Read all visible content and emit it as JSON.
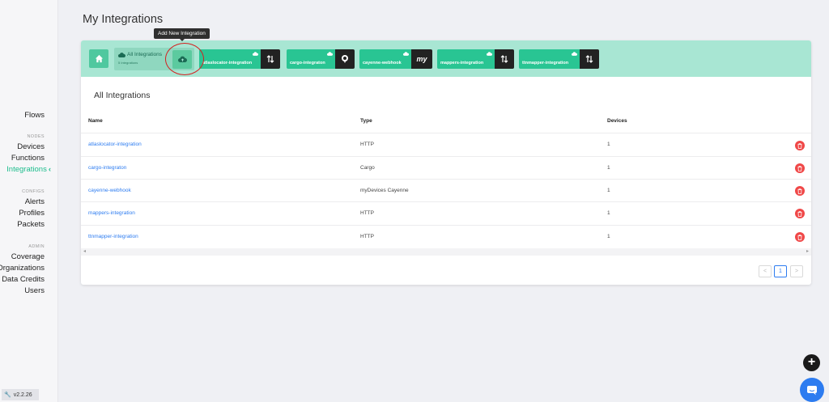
{
  "sidebar": {
    "flows": "Flows",
    "nodes_section": "NODES",
    "devices": "Devices",
    "functions": "Functions",
    "integrations": "Integrations",
    "configs_section": "CONFIGS",
    "alerts": "Alerts",
    "profiles": "Profiles",
    "packets": "Packets",
    "admin_section": "ADMIN",
    "coverage": "Coverage",
    "organizations": "Organizations",
    "data_credits": "Data Credits",
    "users": "Users",
    "version": "v2.2.26"
  },
  "page": {
    "title": "My Integrations"
  },
  "tooltip": {
    "text": "Add New Integration"
  },
  "tabs": {
    "all_label": "All Integrations",
    "all_sub": "5 Integrations",
    "items": [
      {
        "name": "atlaslocator-integration",
        "logo": "arrows-icon"
      },
      {
        "name": "cargo-integraton",
        "logo": "cargo-icon"
      },
      {
        "name": "cayenne-webhook",
        "logo": "my"
      },
      {
        "name": "mappers-integration",
        "logo": "arrows-icon"
      },
      {
        "name": "ttnmapper-integration",
        "logo": "arrows-icon"
      }
    ]
  },
  "table": {
    "title": "All Integrations",
    "headers": {
      "name": "Name",
      "type": "Type",
      "devices": "Devices"
    },
    "rows": [
      {
        "name": "atlaslocator-integration",
        "type": "HTTP",
        "devices": "1"
      },
      {
        "name": "cargo-integraton",
        "type": "Cargo",
        "devices": "1"
      },
      {
        "name": "cayenne-webhook",
        "type": "myDevices Cayenne",
        "devices": "1"
      },
      {
        "name": "mappers-integration",
        "type": "HTTP",
        "devices": "1"
      },
      {
        "name": "ttnmapper-integration",
        "type": "HTTP",
        "devices": "1"
      }
    ]
  },
  "pagination": {
    "prev": "<",
    "current": "1",
    "next": ">"
  },
  "colors": {
    "accent": "#29c593",
    "tabbar": "#a8e6d3",
    "link": "#2d7cf0",
    "delete": "#f04848"
  }
}
